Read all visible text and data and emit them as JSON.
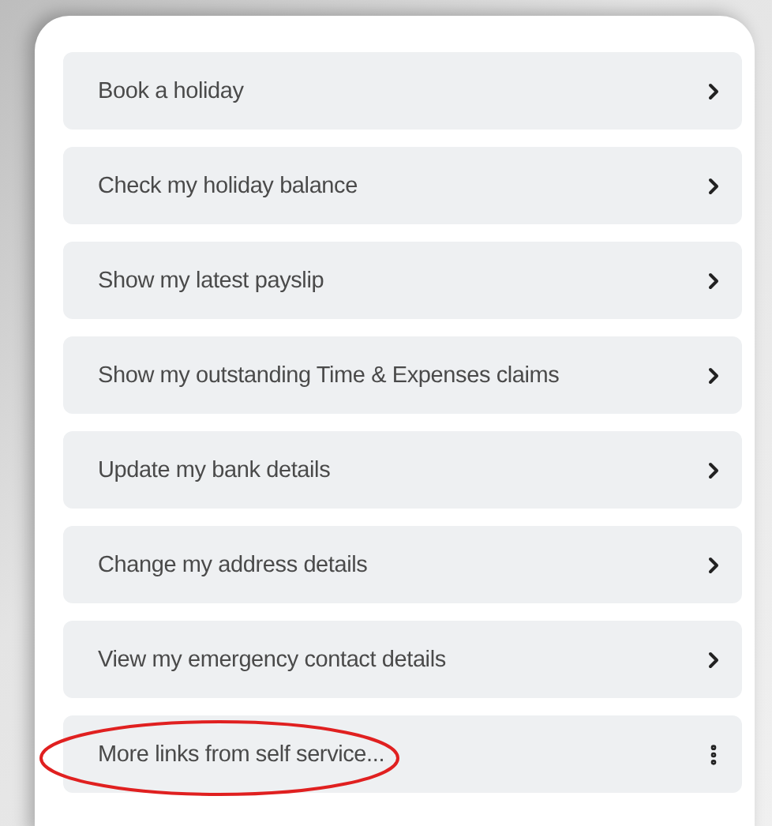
{
  "items": [
    {
      "label": "Book a holiday",
      "kind": "link",
      "circled": false
    },
    {
      "label": "Check my holiday balance",
      "kind": "link",
      "circled": false
    },
    {
      "label": "Show my latest payslip",
      "kind": "link",
      "circled": false
    },
    {
      "label": "Show my outstanding Time & Expenses claims",
      "kind": "link",
      "circled": false
    },
    {
      "label": "Update my bank details",
      "kind": "link",
      "circled": false
    },
    {
      "label": "Change my address details",
      "kind": "link",
      "circled": false
    },
    {
      "label": "View my emergency contact details",
      "kind": "link",
      "circled": false
    },
    {
      "label": "More links from self service...",
      "kind": "more",
      "circled": true
    }
  ]
}
